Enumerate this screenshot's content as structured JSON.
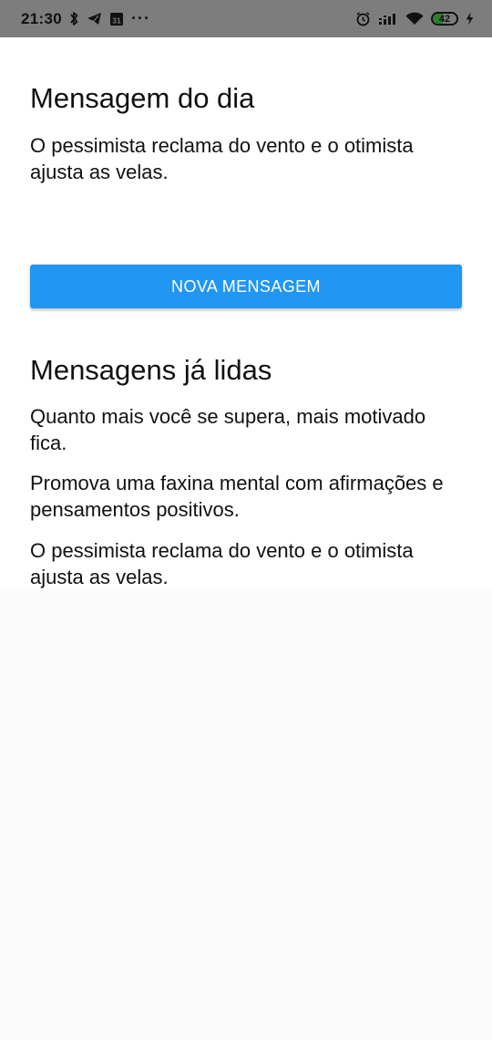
{
  "status_bar": {
    "time": "21:30",
    "calendar_day": "31",
    "more": "···",
    "battery_level": "42",
    "battery_fraction": 0.42
  },
  "daily": {
    "title": "Mensagem do dia",
    "message": "O pessimista reclama do vento e o otimista ajusta as velas."
  },
  "button": {
    "label": "NOVA MENSAGEM",
    "color": "#2196f3"
  },
  "read": {
    "title": "Mensagens já lidas",
    "messages": [
      "Quanto mais você se supera, mais motivado fica.",
      "Promova uma faxina mental com afirmações e pensamentos positivos.",
      "O pessimista reclama do vento e o otimista ajusta as velas."
    ]
  }
}
